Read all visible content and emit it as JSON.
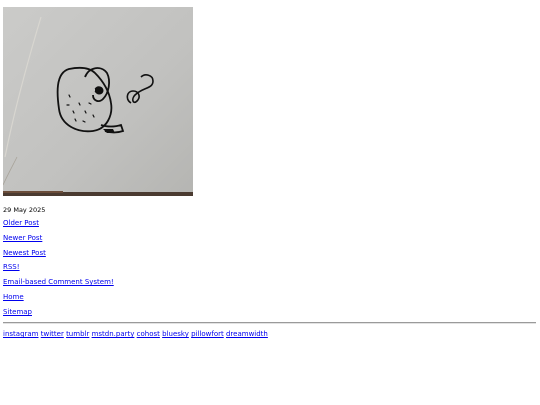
{
  "post": {
    "image_subject": "hand-drawn potato creature sketch",
    "date": "29 May 2025"
  },
  "nav": {
    "older": "Older Post",
    "newer": "Newer Post",
    "newest": "Newest Post",
    "rss": "RSS!",
    "comments": "Email-based Comment System!",
    "home": "Home",
    "sitemap": "Sitemap"
  },
  "social": [
    "instagram",
    "twitter",
    "tumblr",
    "mstdn.party",
    "cohost",
    "bluesky",
    "pillowfort",
    "dreamwidth"
  ],
  "colors": {
    "link": "#0000ee",
    "text": "#000000",
    "background": "#ffffff"
  }
}
